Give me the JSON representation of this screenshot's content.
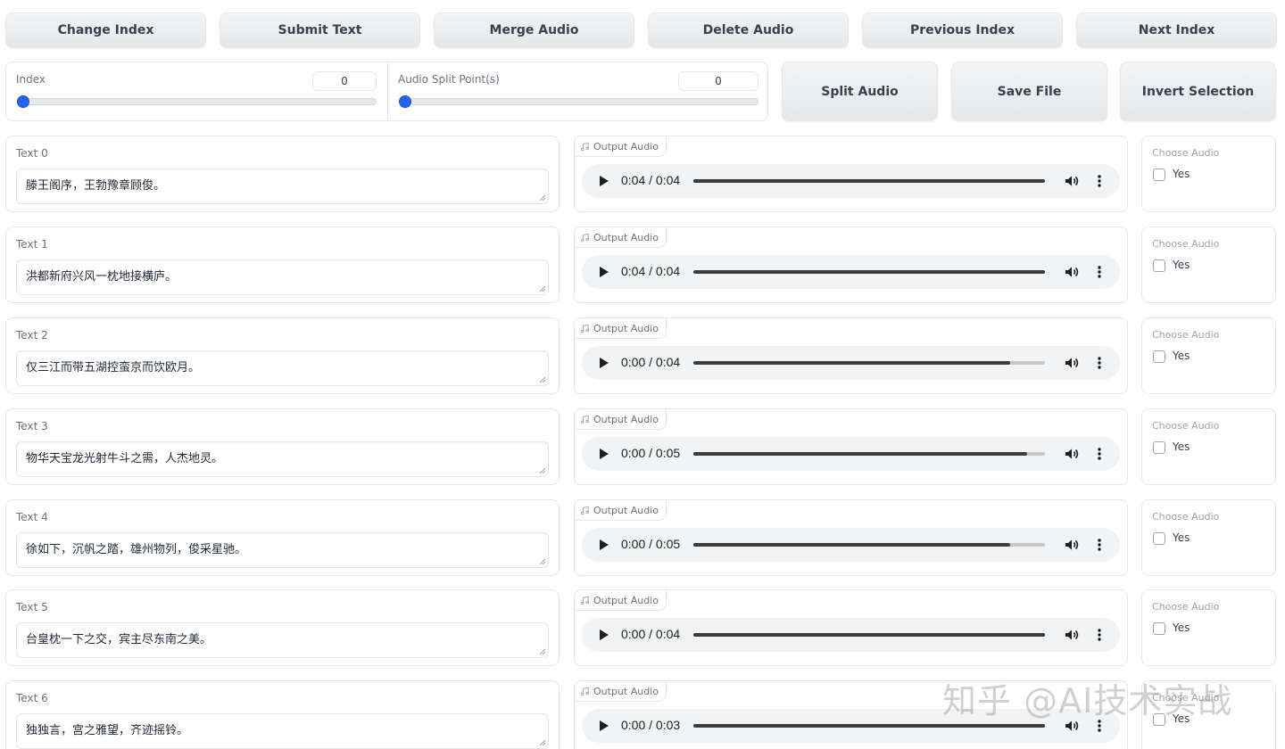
{
  "top_buttons": [
    "Change Index",
    "Submit Text",
    "Merge Audio",
    "Delete Audio",
    "Previous Index",
    "Next Index"
  ],
  "sliders": {
    "index": {
      "label": "Index",
      "value": "0",
      "fraction": 0
    },
    "split": {
      "label": "Audio Split Point(s)",
      "value": "0",
      "fraction": 0
    }
  },
  "action_buttons": [
    "Split Audio",
    "Save File",
    "Invert Selection"
  ],
  "rows": [
    {
      "text_label": "Text 0",
      "text": "滕王阁序，王勃豫章顾俊。",
      "audio_label": "Output Audio",
      "time": "0:04 / 0:04",
      "progress": 1.0,
      "choose_label": "Choose Audio",
      "yes": "Yes"
    },
    {
      "text_label": "Text 1",
      "text": "洪都新府兴风一枕地接横庐。",
      "audio_label": "Output Audio",
      "time": "0:04 / 0:04",
      "progress": 1.0,
      "choose_label": "Choose Audio",
      "yes": "Yes"
    },
    {
      "text_label": "Text 2",
      "text": "仅三江而带五湖控蛮京而饮欧月。",
      "audio_label": "Output Audio",
      "time": "0:00 / 0:04",
      "progress": 0.9,
      "choose_label": "Choose Audio",
      "yes": "Yes"
    },
    {
      "text_label": "Text 3",
      "text": "物华天宝龙光射牛斗之需，人杰地灵。",
      "audio_label": "Output Audio",
      "time": "0:00 / 0:05",
      "progress": 0.95,
      "choose_label": "Choose Audio",
      "yes": "Yes"
    },
    {
      "text_label": "Text 4",
      "text": "徐如下，沉帆之踏，雄州物列，俊采星驰。",
      "audio_label": "Output Audio",
      "time": "0:00 / 0:05",
      "progress": 0.9,
      "choose_label": "Choose Audio",
      "yes": "Yes"
    },
    {
      "text_label": "Text 5",
      "text": "台皇枕一下之交，宾主尽东南之美。",
      "audio_label": "Output Audio",
      "time": "0:00 / 0:04",
      "progress": 1.0,
      "choose_label": "Choose Audio",
      "yes": "Yes"
    },
    {
      "text_label": "Text 6",
      "text": "独独言，宫之雅望，齐迹摇铃。",
      "audio_label": "Output Audio",
      "time": "0:00 / 0:03",
      "progress": 1.0,
      "choose_label": "Choose Audio",
      "yes": "Yes"
    }
  ],
  "watermark": "知乎 @AI技术实战"
}
